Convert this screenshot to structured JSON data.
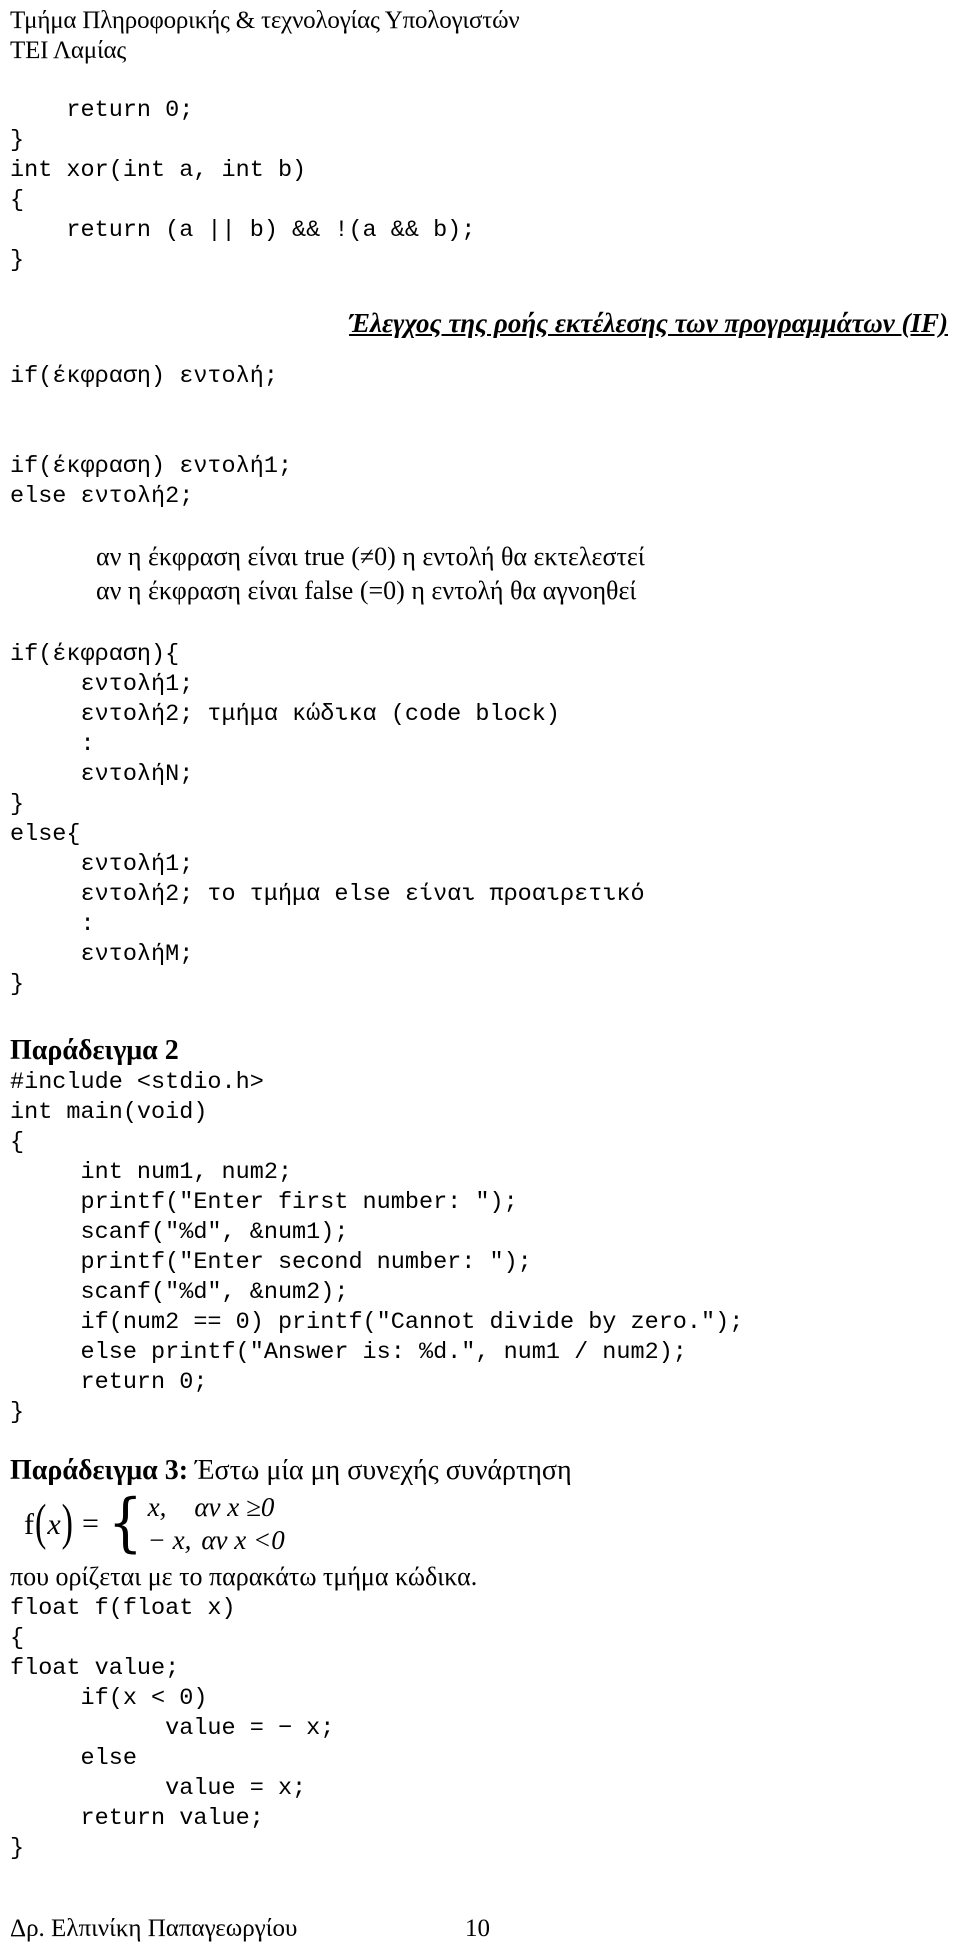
{
  "header": {
    "line1": "Τμήμα Πληροφορικής & τεχνολογίας Υπολογιστών",
    "line2": "ΤΕΙ Λαμίας"
  },
  "code_top": [
    "    return 0;",
    "}",
    "",
    "int xor(int a, int b)",
    "{",
    "    return (a || b) && !(a && b);",
    "}"
  ],
  "section_heading": "Έλεγχος της ροής εκτέλεσης των προγραμμάτων (IF)",
  "if_simple": "if(έκφραση) εντολή;",
  "if_else_simple": [
    "if(έκφραση) εντολή1;",
    "else εντολή2;"
  ],
  "semantics": [
    "αν η έκφραση είναι true (≠0) η εντολή θα εκτελεστεί",
    "αν η έκφραση είναι false (=0) η εντολή θα αγνοηθεί"
  ],
  "if_else_block": [
    "if(έκφραση){",
    "     εντολή1;",
    "     εντολή2; τμήμα κώδικα (code block)",
    "     :",
    "     εντολήΝ;",
    "}",
    "else{",
    "     εντολή1;",
    "     εντολή2; το τμήμα else είναι προαιρετικό",
    "     :",
    "     εντολήΜ;",
    "}"
  ],
  "example2": {
    "heading": "Παράδειγμα 2",
    "code": [
      "#include <stdio.h>",
      "int main(void)",
      "{",
      "     int num1, num2;",
      "     printf(\"Enter first number: \");",
      "     scanf(\"%d\", &num1);",
      "     printf(\"Enter second number: \");",
      "     scanf(\"%d\", &num2);",
      "",
      "     if(num2 == 0) printf(\"Cannot divide by zero.\");",
      "     else printf(\"Answer is: %d.\", num1 / num2);",
      "     return 0;",
      "}"
    ]
  },
  "example3": {
    "heading_bold": "Παράδειγμα 3:",
    "heading_tail": " Έστω μία μη συνεχής συνάρτηση",
    "formula": {
      "lhs_f": "f",
      "lhs_open": "(",
      "lhs_var": "x",
      "lhs_close": ")",
      "equals": "=",
      "brace": "{",
      "case1_value": "x,",
      "case1_cond": "αν x ≥0",
      "case2_value": "− x,",
      "case2_cond": "αν x <0"
    },
    "note": "που ορίζεται με το παρακάτω τμήμα κώδικα.",
    "code": [
      "float f(float x)",
      "{",
      "float value;",
      "     if(x < 0)",
      "           value = − x;",
      "     else",
      "           value = x;",
      "     return value;",
      "}"
    ]
  },
  "footer": {
    "author": "Δρ. Ελπινίκη Παπαγεωργίου",
    "page": "10"
  }
}
